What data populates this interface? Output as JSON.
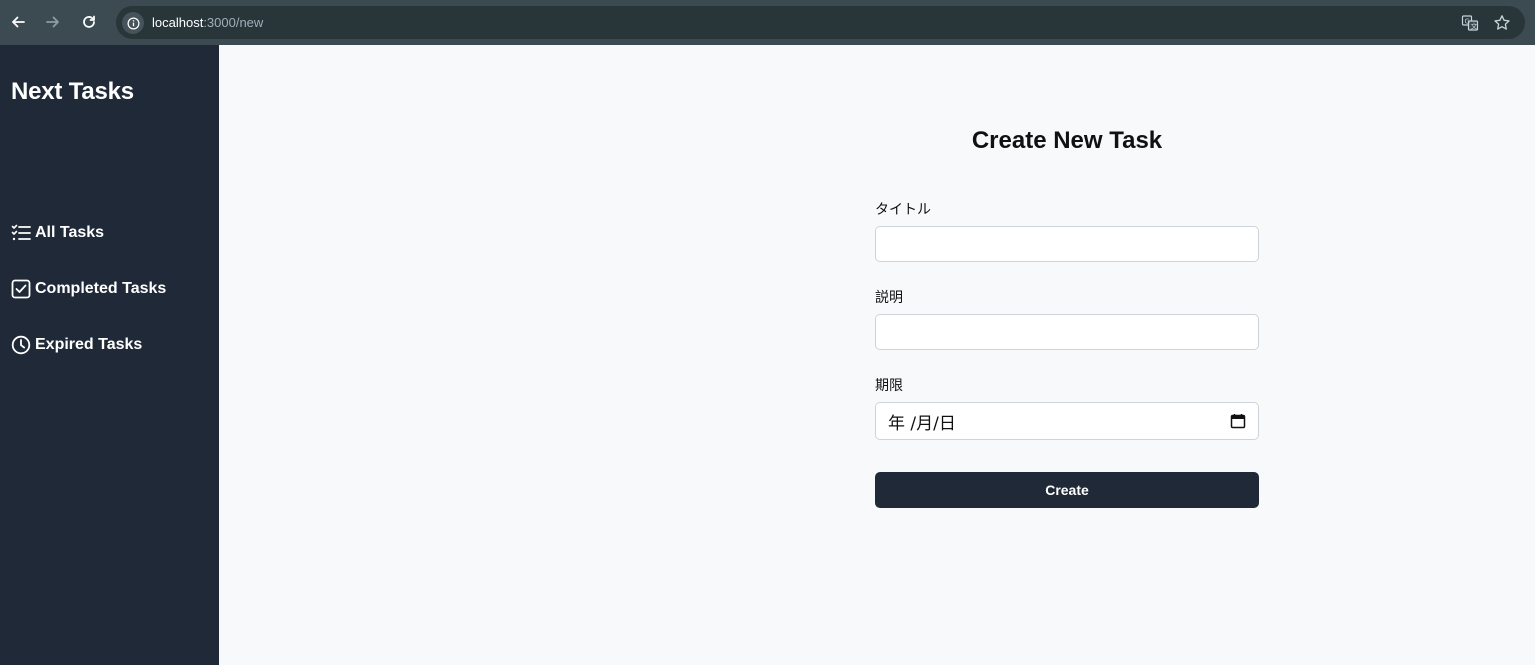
{
  "browser": {
    "url_host": "localhost",
    "url_path": ":3000/new"
  },
  "sidebar": {
    "brand": "Next Tasks",
    "items": [
      {
        "label": "All Tasks",
        "icon": "list-check-icon"
      },
      {
        "label": "Completed Tasks",
        "icon": "checkbox-icon"
      },
      {
        "label": "Expired Tasks",
        "icon": "clock-icon"
      }
    ]
  },
  "form": {
    "title": "Create New Task",
    "title_label": "タイトル",
    "title_value": "",
    "description_label": "説明",
    "description_value": "",
    "deadline_label": "期限",
    "deadline_placeholder": "年 /月/日",
    "submit_label": "Create"
  },
  "colors": {
    "sidebar_bg": "#1f2937",
    "page_bg": "#f8f9fb",
    "button_bg": "#1f2937",
    "browser_bar": "#3c4a52"
  }
}
